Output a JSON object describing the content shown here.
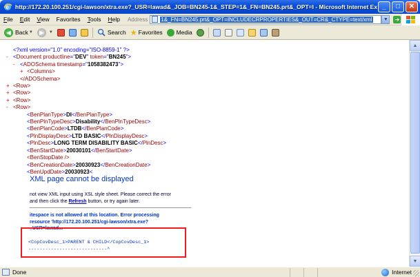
{
  "window": {
    "title": "http://172.20.100.251/cgi-lawson/xtra.exe?_USR=lawad&_JOB=BN245-1&_STEP=1&_FN=BN245.prt&_OPT=I - Microsoft Internet Explorer",
    "buttons": [
      "minimize",
      "maximize",
      "close"
    ]
  },
  "menubar": {
    "items": [
      "File",
      "Edit",
      "View",
      "Favorites",
      "Tools",
      "Help"
    ],
    "accelerators": [
      "F",
      "E",
      "V",
      "",
      "T",
      "H"
    ],
    "address_label": "Address",
    "address_value": "1&_FN=BN245.prt&_OPT=INCLUDECRPROPERTIES&_OUT=CR&_CTYPE=text/xml",
    "go_label": "Go"
  },
  "toolbar": {
    "back_label": "Back",
    "search_label": "Search",
    "favorites_label": "Favorites",
    "media_label": "Media"
  },
  "xml": {
    "decl": "<?xml version=\"1.0\" encoding=\"ISO-8859-1\" ?>",
    "doc_tag": "Document",
    "productline_attr": "productline",
    "productline_val": "DEV",
    "token_attr": "token",
    "token_val": "BN245",
    "adoschema_tag": "ADOSchema",
    "timestamp_attr": "timestamp",
    "timestamp_val": "1058382473",
    "columns_tag": "<Columns>",
    "adoschema_close": "</ADOSchema>",
    "row_tag": "<Row>",
    "fields": [
      {
        "tag": "BenPlanType",
        "value": "DI"
      },
      {
        "tag": "BenPlnTypeDesc",
        "value": "Disability"
      },
      {
        "tag": "BenPlanCode",
        "value": "LTDB"
      },
      {
        "tag": "PlnDisplayDesc",
        "value": "LTD BASIC"
      },
      {
        "tag": "PlnDesc",
        "value": "LONG TERM DISABILITY BASIC"
      },
      {
        "tag": "BenStartDate",
        "value": "20030101"
      },
      {
        "tag": "BenStopDate",
        "value": ""
      },
      {
        "tag": "BenCreationDate",
        "value": "20030923"
      },
      {
        "tag": "BenUpdDate",
        "value": "20030923"
      }
    ],
    "stop_date_selfclose": "<BenStopDate />",
    "trailing_lt": "<"
  },
  "error": {
    "title": "XML page cannot be displayed",
    "body_line1": "not view XML input using XSL style sheet. Please correct the error",
    "body_line2_a": "and then click the ",
    "refresh_link": "Refresh",
    "body_line2_b": " button, or try again later.",
    "detail_line1": "itespace is not allowed at this location. Error processing",
    "detail_line2": "resource 'http://172.20.100.251/cgi-lawson/xtra.exe?",
    "detail_line3": "_USR=lawad...",
    "source_line": "<CopCovDesc_1>PARENT & CHILD</CopCovDesc_1>",
    "caret_line": "----------------------------^"
  },
  "statusbar": {
    "status_text": "Done",
    "zone_text": "Internet"
  },
  "colors": {
    "tag": "#990000",
    "symbol": "#0000ff",
    "highlight_box": "#ee1c1c",
    "error_title": "#0033cc"
  }
}
